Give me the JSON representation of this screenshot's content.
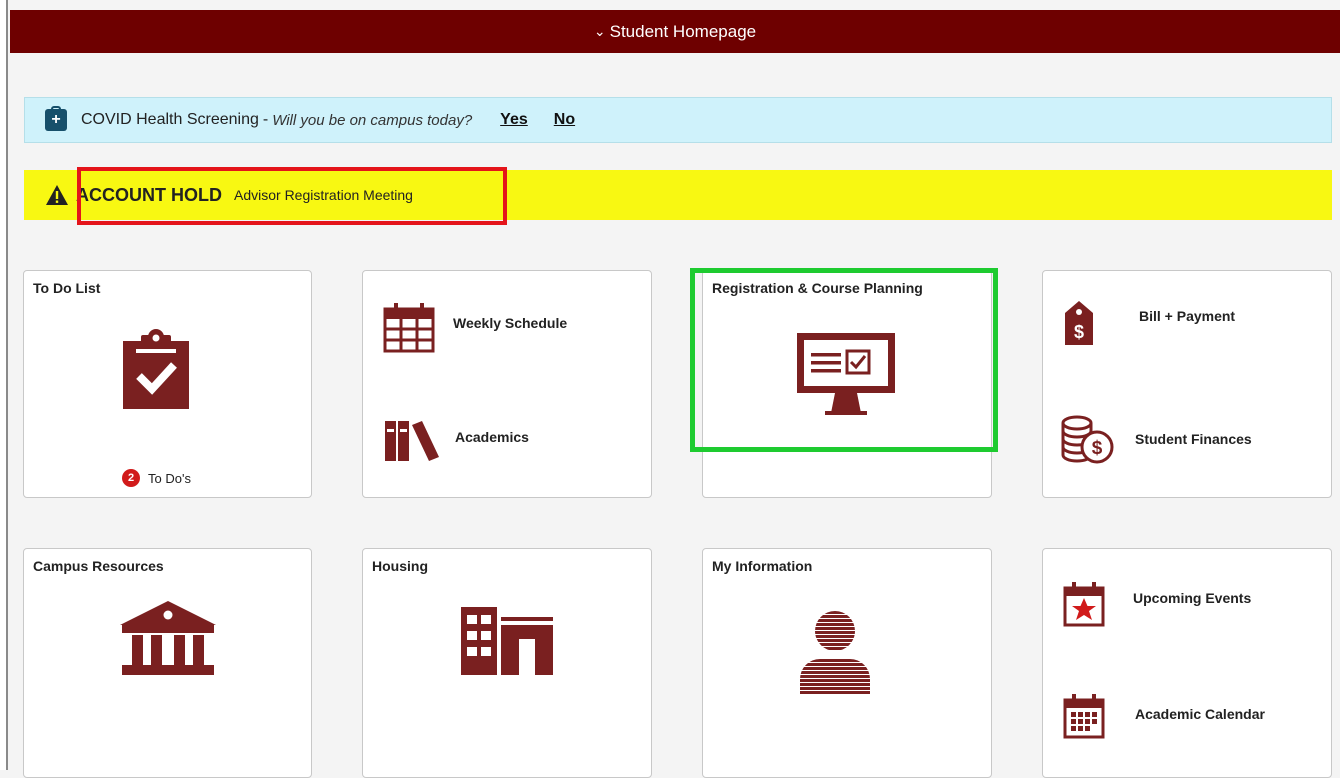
{
  "header": {
    "title": "Student Homepage",
    "chevron": "chevron-down-icon"
  },
  "covid": {
    "icon": "medical-kit-icon",
    "title": "COVID Health Screening",
    "separator": "-",
    "question": "Will you be on campus today?",
    "yes": "Yes",
    "no": "No"
  },
  "hold": {
    "icon": "warning-icon",
    "title": "ACCOUNT HOLD",
    "detail": "Advisor Registration Meeting"
  },
  "tiles": {
    "todo": {
      "title": "To Do List",
      "icon": "clipboard-check-icon",
      "count": "2",
      "count_label": "To Do's"
    },
    "schedule": {
      "weekly": {
        "label": "Weekly Schedule",
        "icon": "calendar-icon"
      },
      "academics": {
        "label": "Academics",
        "icon": "books-icon"
      }
    },
    "registration": {
      "title": "Registration & Course Planning",
      "icon": "monitor-checklist-icon"
    },
    "finance": {
      "bill": {
        "label": "Bill + Payment",
        "icon": "price-tag-icon"
      },
      "finances": {
        "label": "Student Finances",
        "icon": "coins-icon"
      }
    },
    "campus": {
      "title": "Campus Resources",
      "icon": "building-columns-icon"
    },
    "housing": {
      "title": "Housing",
      "icon": "apartment-building-icon"
    },
    "info": {
      "title": "My Information",
      "icon": "person-icon"
    },
    "events": {
      "upcoming": {
        "label": "Upcoming Events",
        "icon": "calendar-star-icon"
      },
      "calendar": {
        "label": "Academic Calendar",
        "icon": "calendar-grid-icon"
      }
    }
  },
  "colors": {
    "brand": "#6e0000",
    "icon": "#7a2020",
    "covid_bg": "#cff2fb",
    "hold_bg": "#f8f812",
    "highlight_red": "#e4141a",
    "highlight_green": "#1ecb30"
  }
}
